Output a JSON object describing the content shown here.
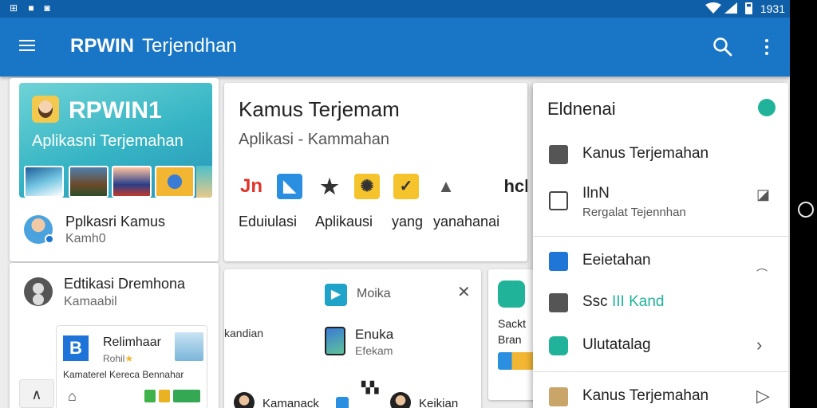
{
  "status_bar": {
    "time": "1931"
  },
  "app_bar": {
    "title_bold": "RPWIN",
    "title_rest": "Terjendhan"
  },
  "hero": {
    "title": "RPWIN1",
    "subtitle": "Aplikasni Terjemahan"
  },
  "left_list": [
    {
      "title": "Pplkasri Kamus",
      "subtitle": "Kamh0"
    },
    {
      "title": "Edtikasi Dremhona",
      "subtitle": "Kamaabil"
    }
  ],
  "mini_card": {
    "badge": "B",
    "title": "Relimhaar",
    "subtitle": "Rohil",
    "caption": "Kamaterel Kereca Bennahar"
  },
  "center_card": {
    "title": "Kamus Terjemam",
    "subtitle": "Aplikasi - Kammahan",
    "icon_labels": [
      "Jn",
      "hcb"
    ],
    "labels": [
      "Eduiulasi",
      "Aplikausi",
      "yang",
      "yanahanai"
    ]
  },
  "center_card2": {
    "label": "Moika",
    "side_text": "kandian",
    "title": "Enuka",
    "subtitle": "Efekam",
    "name1": "Kamanack",
    "name2": "Keikian"
  },
  "mini_right": {
    "line1": "Sackt",
    "line2": "Bran"
  },
  "drawer": {
    "title": "Eldnenai",
    "items": [
      {
        "label": "Kanus Terjemahan",
        "icon": "briefcase-icon"
      },
      {
        "label": "IlnN",
        "sublabel": "Rergalat Tejennhan",
        "icon": "document-icon"
      },
      {
        "label": "Eeietahan",
        "icon": "app-l-icon"
      },
      {
        "label": "Ssc",
        "label_accent": "III Kand",
        "icon": "bag-icon"
      },
      {
        "label": "Ulutatalag",
        "icon": "shield-icon"
      },
      {
        "label": "Kanus Terjemahan",
        "icon": "folder-icon"
      }
    ],
    "accent_color": "#21b39a"
  },
  "colors": {
    "app_bar": "#1976c6",
    "status_bar": "#0f5fa8"
  }
}
